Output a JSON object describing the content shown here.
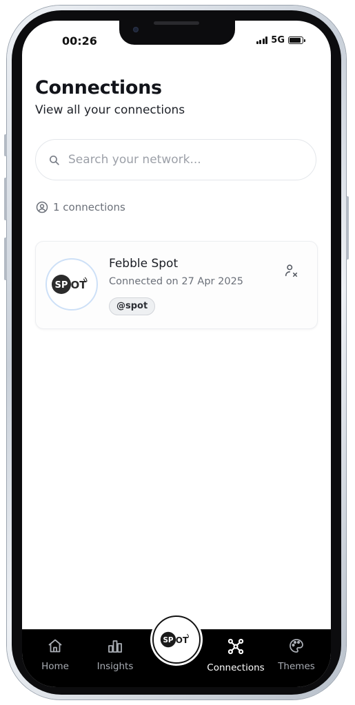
{
  "status_bar": {
    "time": "00:26",
    "network": "5G"
  },
  "header": {
    "title": "Connections",
    "subtitle": "View all your connections"
  },
  "search": {
    "placeholder": "Search your network...",
    "value": ""
  },
  "summary": {
    "count_text": "1 connections"
  },
  "connections": [
    {
      "name": "Febble Spot",
      "connected_text": "Connected on 27 Apr 2025",
      "handle": "@spot",
      "avatar_logo_text": "SPOT",
      "avatar_brand_color": "#2b2b2b"
    }
  ],
  "bottom_nav": {
    "items": [
      {
        "label": "Home",
        "icon": "home-icon",
        "active": false
      },
      {
        "label": "Insights",
        "icon": "bar-chart-icon",
        "active": false
      },
      {
        "label": "Connections",
        "icon": "network-icon",
        "active": true
      },
      {
        "label": "Themes",
        "icon": "palette-icon",
        "active": false
      }
    ],
    "center_logo_text": "SPOT"
  },
  "colors": {
    "accent_active": "#ffffff",
    "nav_background": "#000000",
    "muted_text": "#6b7079"
  }
}
